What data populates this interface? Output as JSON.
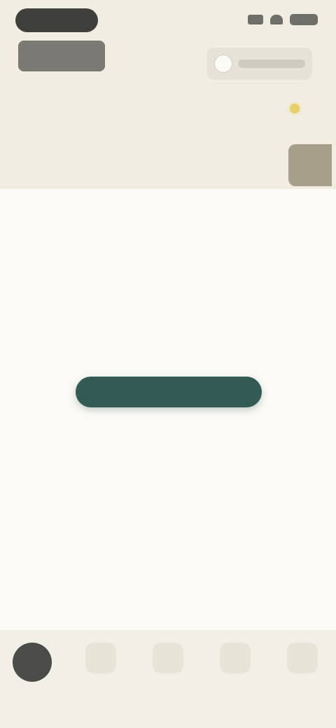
{
  "status_bar": {
    "time": "",
    "icons": [
      "signal-icon",
      "wifi-icon",
      "battery-icon"
    ]
  },
  "header": {
    "brand": "",
    "user_label": "",
    "date_day": "",
    "date_num": "",
    "weather_icon": "sun-icon",
    "weather_text": ""
  },
  "days": [
    {
      "label": "",
      "active": false
    },
    {
      "label": "",
      "active": false
    },
    {
      "label": "",
      "active": false
    },
    {
      "label": "",
      "active": false
    },
    {
      "label": "",
      "active": false
    },
    {
      "label": "",
      "active": false
    },
    {
      "label": "",
      "active": true
    }
  ],
  "main": {
    "empty_message": "",
    "cta_label": "",
    "secondary_link": "",
    "tertiary_link": ""
  },
  "bottom_nav": {
    "items": [
      {
        "label": "",
        "active": true
      },
      {
        "label": "",
        "active": false
      },
      {
        "label": "",
        "active": false
      },
      {
        "label": "",
        "active": false
      },
      {
        "label": "",
        "active": false
      }
    ]
  },
  "colors": {
    "header_bg": "#f1ede2",
    "main_bg": "#fbfaf6",
    "accent": "#335a55",
    "active_day": "#a79f8a",
    "nav_active": "#4b4b49"
  }
}
